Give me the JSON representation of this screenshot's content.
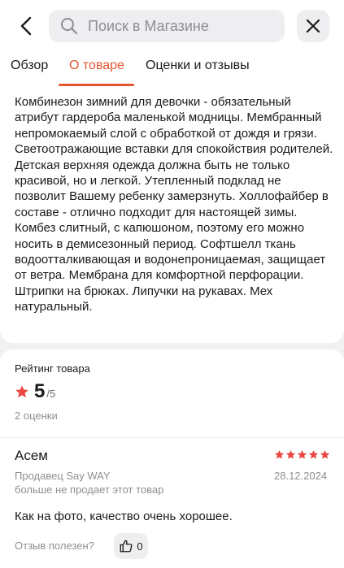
{
  "header": {
    "search_placeholder": "Поиск в Магазине",
    "back_icon": "chevron-left-icon",
    "close_icon": "close-icon"
  },
  "tabs": [
    {
      "label": "Обзор",
      "active": false
    },
    {
      "label": "О товаре",
      "active": true
    },
    {
      "label": "Оценки и отзывы",
      "active": false
    }
  ],
  "description": {
    "text": "Комбинезон зимний для девочки - обязательный атрибут гардероба маленькой модницы. Мембранный непромокаемый слой с обработкой от дождя и грязи. Светоотражающие вставки для спокойствия родителей. Детская верхняя одежда должна быть не только красивой, но и легкой. Утепленный подклад не позволит Вашему ребенку замерзнуть. Холлофайбер в составе - отлично подходит для настоящей зимы. Комбез слитный, с капюшоном, поэтому его можно носить в демисезонный период. Софтшелл ткань водоотталкивающая и водонепроницаемая, защищает от ветра. Мембрана для комфортной перфорации. Штрипки на брюках. Липучки на рукавах. Мех натуральный."
  },
  "rating": {
    "title": "Рейтинг товара",
    "value": "5",
    "max": "/5",
    "count": "2 оценки"
  },
  "review": {
    "author": "Асем",
    "stars": 5,
    "seller": "Продавец Say WAY",
    "date": "28.12.2024",
    "seller_note": "больше не продает этот товар",
    "text": "Как на фото, качество очень хорошее.",
    "helpful_label": "Отзыв полезен?",
    "helpful_count": "0"
  },
  "colors": {
    "accent": "#e2562d",
    "star": "#e8483f",
    "background": "#f1f1f3",
    "muted_text": "#8e8e93"
  }
}
